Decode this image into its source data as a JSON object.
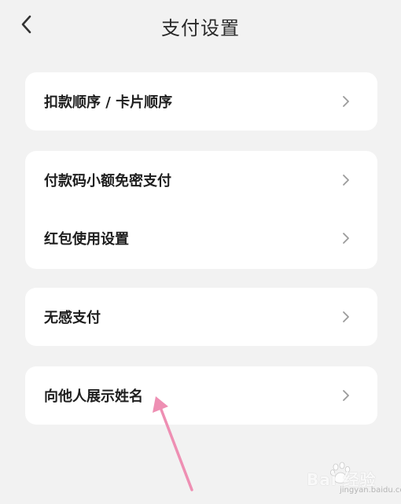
{
  "header": {
    "title": "支付设置",
    "back_icon": "chevron-left-icon"
  },
  "groups": [
    {
      "items": [
        {
          "label": "扣款顺序 / 卡片顺序"
        }
      ]
    },
    {
      "items": [
        {
          "label": "付款码小额免密支付"
        },
        {
          "label": "红包使用设置"
        }
      ]
    },
    {
      "items": [
        {
          "label": "无感支付"
        }
      ]
    },
    {
      "items": [
        {
          "label": "向他人展示姓名"
        }
      ]
    }
  ],
  "colors": {
    "background": "#f2f2f2",
    "card": "#ffffff",
    "text": "#1e1e1e",
    "chevron": "#9b9b9b",
    "annotation_arrow": "#ee8fb3"
  },
  "watermark": {
    "brand": "Bai  经验",
    "url": "jingyan.baidu.com"
  }
}
